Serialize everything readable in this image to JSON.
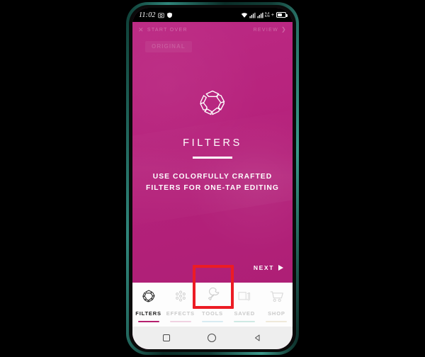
{
  "device": {
    "frame_color": "#2f857a",
    "background_color": "#000000"
  },
  "status_bar": {
    "time": "11:02",
    "left_icons": [
      "camera-icon",
      "shield-icon"
    ],
    "right_icons": [
      "wifi-icon",
      "signal-icon",
      "signal-icon",
      "data-speed-icon",
      "battery-icon"
    ],
    "data_speed_top": "5.4",
    "data_speed_bottom": "K/S",
    "battery_plus": "+"
  },
  "app_bar": {
    "start_over_label": "START OVER",
    "start_over_icon": "close-icon",
    "review_label": "REVIEW",
    "review_icon": "chevron-right-icon"
  },
  "photo": {
    "ghost_chip_label": "ORIGINAL",
    "background_color": "#b9257f"
  },
  "overlay": {
    "icon": "filters-hexagon-icon",
    "title": "FILTERS",
    "description_line1": "USE COLORFULLY CRAFTED",
    "description_line2": "FILTERS FOR ONE-TAP EDITING",
    "next_label": "NEXT",
    "next_icon": "play-triangle-icon"
  },
  "tab_bar": {
    "tabs": [
      {
        "label": "FILTERS",
        "icon": "filters-hexagon-icon",
        "active": true,
        "indicator_color": "#b5206f"
      },
      {
        "label": "EFFECTS",
        "icon": "dots-cluster-icon",
        "active": false,
        "indicator_color": "#f0d3e2"
      },
      {
        "label": "TOOLS",
        "icon": "wrench-icon",
        "active": false,
        "indicator_color": "#d8ebf2"
      },
      {
        "label": "SAVED",
        "icon": "layers-stack-icon",
        "active": false,
        "indicator_color": "#cfe9e4"
      },
      {
        "label": "SHOP",
        "icon": "shopping-cart-icon",
        "active": false,
        "indicator_color": "#efe9da"
      }
    ]
  },
  "annotation": {
    "target_tab": "TOOLS",
    "color": "#ec1c24",
    "shape": "rectangle-highlight"
  },
  "nav_bar": {
    "buttons": [
      "recents-square-icon",
      "home-circle-icon",
      "back-triangle-icon"
    ]
  }
}
